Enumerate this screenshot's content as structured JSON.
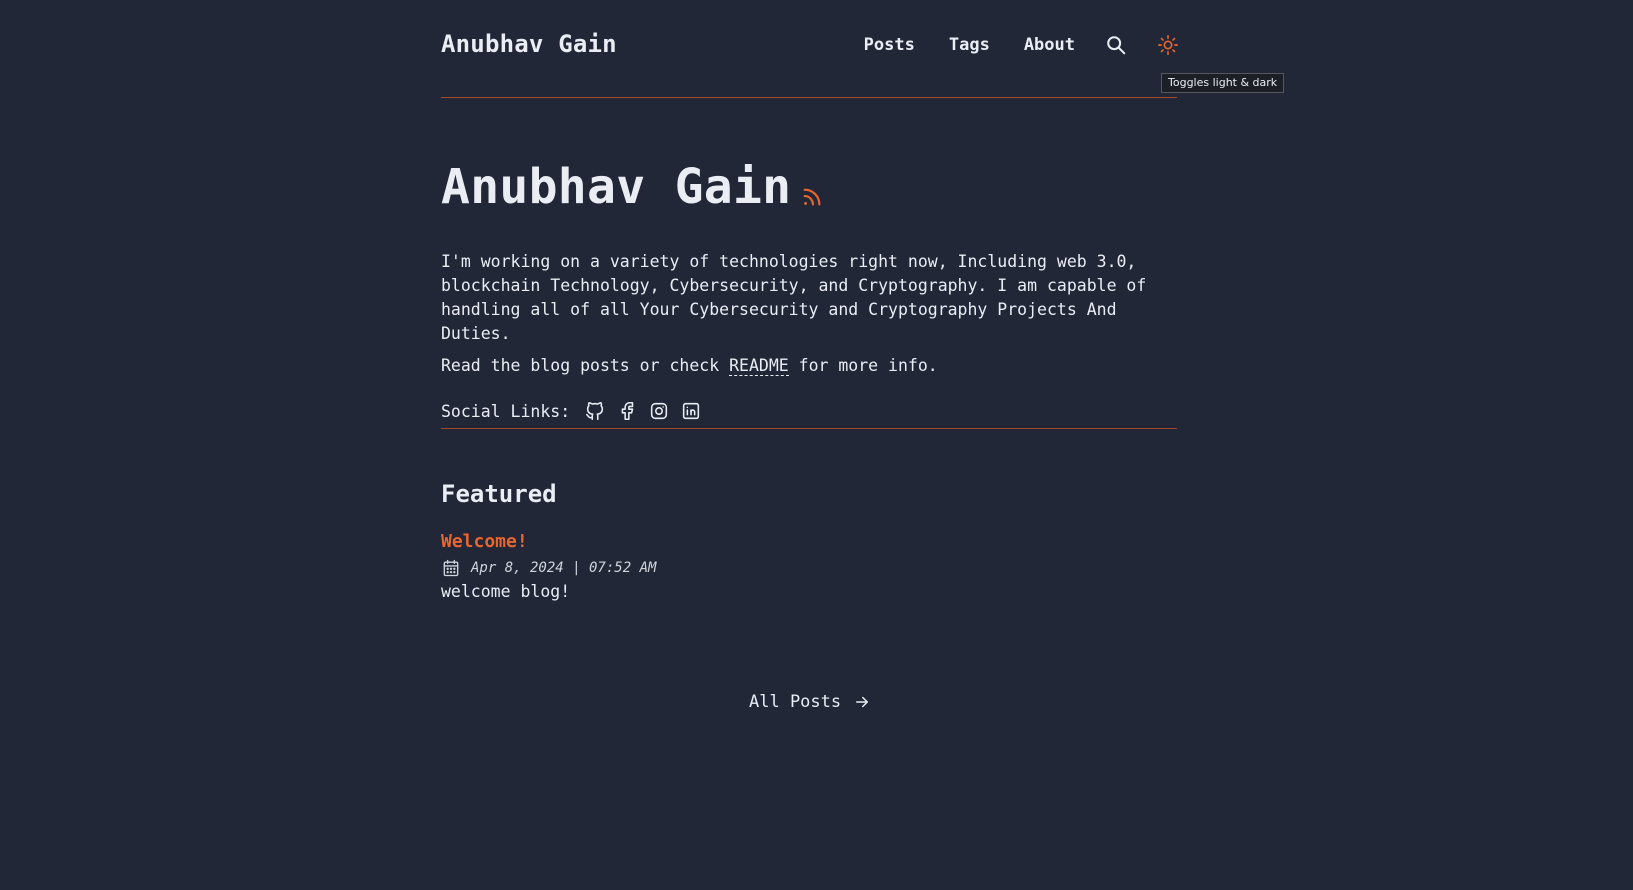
{
  "header": {
    "site_title": "Anubhav Gain",
    "nav": [
      {
        "label": "Posts"
      },
      {
        "label": "Tags"
      },
      {
        "label": "About"
      }
    ],
    "search_icon": "search-icon",
    "theme_icon": "sun-icon",
    "theme_tooltip": "Toggles light & dark"
  },
  "hero": {
    "title": "Anubhav Gain",
    "rss_icon": "rss-icon",
    "description": "I'm working on a variety of technologies right now, Including web 3.0, blockchain Technology, Cybersecurity, and Cryptography. I am capable of handling all of all Your Cybersecurity and Cryptography Projects And Duties.",
    "readme_prefix": "Read the blog posts or check ",
    "readme_link": "README",
    "readme_suffix": " for more info.",
    "social_label": "Social Links:",
    "social_icons": [
      "github-icon",
      "facebook-icon",
      "instagram-icon",
      "linkedin-icon"
    ]
  },
  "featured": {
    "heading": "Featured",
    "posts": [
      {
        "title": "Welcome!",
        "date": "Apr 8, 2024 | 07:52 AM",
        "description": "welcome blog!"
      }
    ]
  },
  "footer_nav": {
    "all_posts_label": "All Posts"
  },
  "colors": {
    "background": "#212737",
    "text": "#eaedf3",
    "accent": "#e8652f",
    "divider": "#a04a2a"
  }
}
